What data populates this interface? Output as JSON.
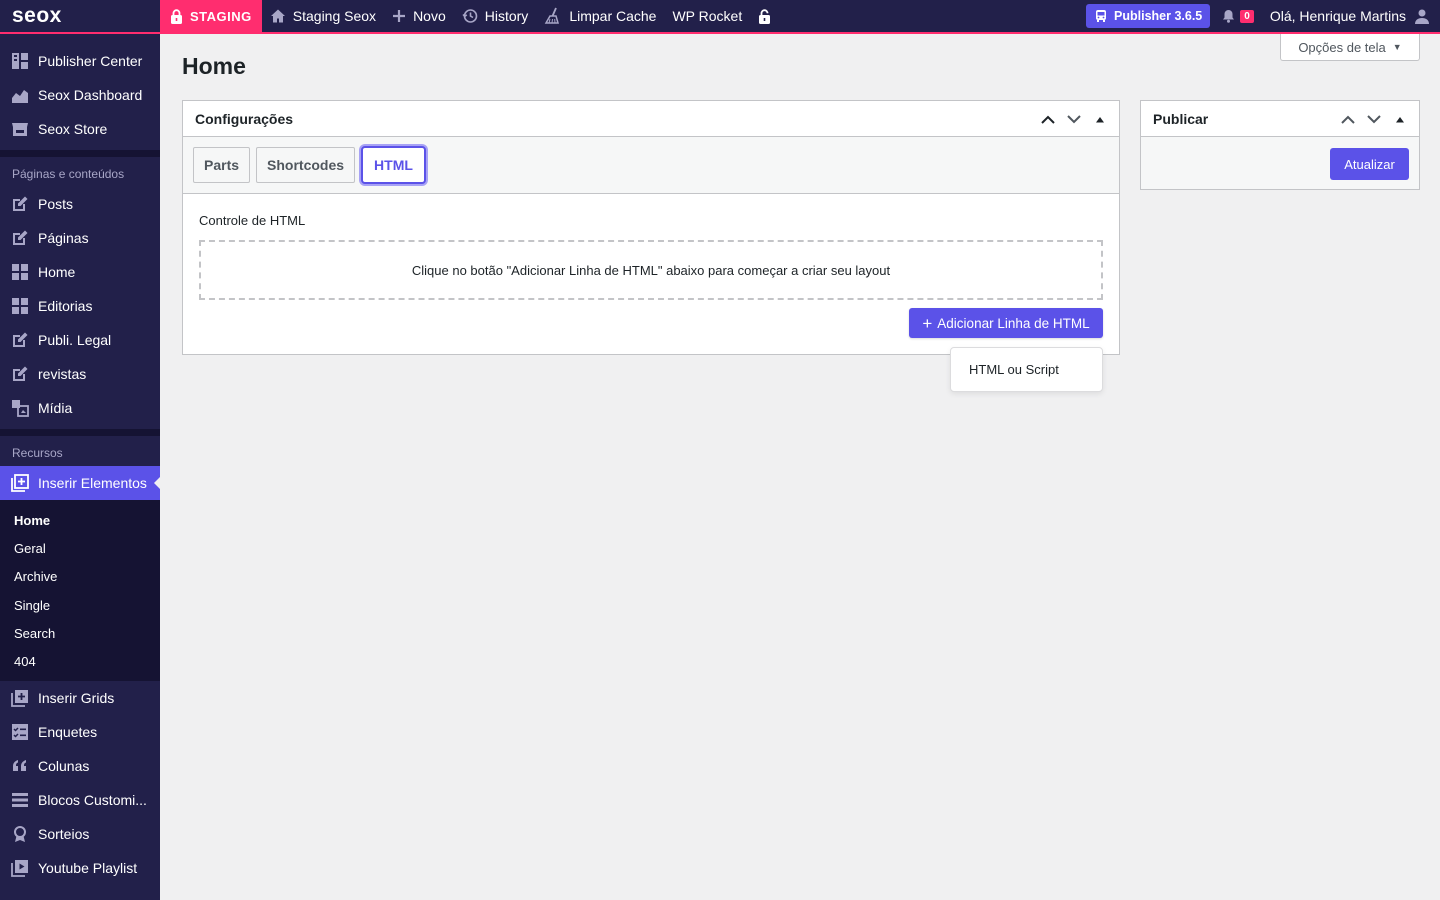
{
  "adminbar": {
    "logo": "seox",
    "staging": "STAGING",
    "site_name": "Staging Seox",
    "new_label": "Novo",
    "history_label": "History",
    "cache_label": "Limpar Cache",
    "rocket_label": "WP Rocket",
    "publisher_label": "Publisher 3.6.5",
    "notif_count": "0",
    "greeting": "Olá, Henrique Martins"
  },
  "sidebar": {
    "top_items": [
      {
        "label": "Publisher Center",
        "icon": "grid-panel-icon"
      },
      {
        "label": "Seox Dashboard",
        "icon": "area-chart-icon"
      },
      {
        "label": "Seox Store",
        "icon": "store-icon"
      }
    ],
    "section1_heading": "Páginas e conteúdos",
    "section1_items": [
      {
        "label": "Posts",
        "icon": "edit-icon"
      },
      {
        "label": "Páginas",
        "icon": "edit-icon"
      },
      {
        "label": "Home",
        "icon": "grid-icon"
      },
      {
        "label": "Editorias",
        "icon": "grid-icon"
      },
      {
        "label": "Publi. Legal",
        "icon": "edit-icon"
      },
      {
        "label": "revistas",
        "icon": "edit-icon"
      },
      {
        "label": "Mídia",
        "icon": "media-icon"
      }
    ],
    "section2_heading": "Recursos",
    "active_item": {
      "label": "Inserir Elementos",
      "icon": "add-box-icon"
    },
    "submenu": [
      "Home",
      "Geral",
      "Archive",
      "Single",
      "Search",
      "404"
    ],
    "bottom_items": [
      {
        "label": "Inserir Grids",
        "icon": "add-box-icon"
      },
      {
        "label": "Enquetes",
        "icon": "poll-icon"
      },
      {
        "label": "Colunas",
        "icon": "quote-icon"
      },
      {
        "label": "Blocos Customi...",
        "icon": "blocks-icon"
      },
      {
        "label": "Sorteios",
        "icon": "award-icon"
      },
      {
        "label": "Youtube Playlist",
        "icon": "playlist-icon"
      }
    ]
  },
  "main": {
    "screen_options": "Opções de tela",
    "page_title": "Home",
    "config_box": {
      "title": "Configurações",
      "tabs": [
        "Parts",
        "Shortcodes",
        "HTML"
      ],
      "active_tab": "HTML",
      "control_label": "Controle de HTML",
      "empty_message": "Clique no botão \"Adicionar Linha de HTML\" abaixo para começar a criar seu layout",
      "add_button": "Adicionar Linha de HTML",
      "dropdown_option": "HTML ou Script"
    },
    "publish_box": {
      "title": "Publicar",
      "update_button": "Atualizar"
    }
  },
  "colors": {
    "accent": "#5b52e8",
    "admin_bg": "#22204a",
    "staging": "#ff2d6f"
  }
}
